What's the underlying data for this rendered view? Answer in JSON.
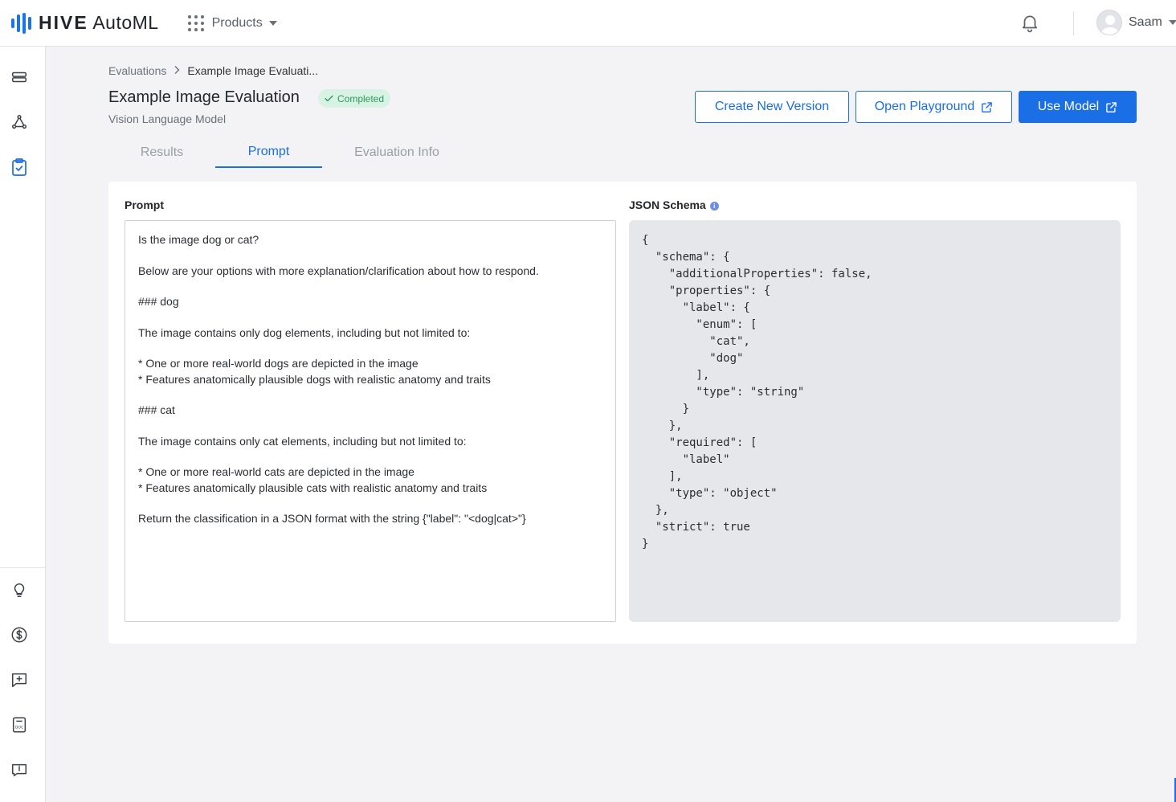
{
  "brand": {
    "name_bold": "HIVE",
    "name_light": "AutoML",
    "accent": "#1a6fe6"
  },
  "header": {
    "products_label": "Products",
    "user_name": "Saam"
  },
  "sidebar": {
    "top_items": [
      {
        "icon": "layers-icon"
      },
      {
        "icon": "nodes-icon"
      },
      {
        "icon": "clipboard-check-icon",
        "active": true
      }
    ],
    "bottom_items": [
      {
        "icon": "lightbulb-icon"
      },
      {
        "icon": "dollar-icon"
      },
      {
        "icon": "feedback-icon"
      },
      {
        "icon": "document-icon"
      },
      {
        "icon": "chat-info-icon"
      }
    ]
  },
  "breadcrumb": {
    "parent": "Evaluations",
    "current": "Example Image Evaluati..."
  },
  "page": {
    "title": "Example Image Evaluation",
    "status": "Completed",
    "subtitle": "Vision Language Model"
  },
  "actions": {
    "create_version": "Create New Version",
    "open_playground": "Open Playground",
    "use_model": "Use Model"
  },
  "tabs": [
    {
      "label": "Results",
      "active": false
    },
    {
      "label": "Prompt",
      "active": true
    },
    {
      "label": "Evaluation Info",
      "active": false
    }
  ],
  "prompt_panel": {
    "label": "Prompt",
    "text": "Is the image dog or cat?\n\nBelow are your options with more explanation/clarification about how to respond.\n\n### dog\n\nThe image contains only dog elements, including but not limited to:\n\n* One or more real-world dogs are depicted in the image\n* Features anatomically plausible dogs with realistic anatomy and traits\n\n### cat\n\nThe image contains only cat elements, including but not limited to:\n\n* One or more real-world cats are depicted in the image\n* Features anatomically plausible cats with realistic anatomy and traits\n\nReturn the classification in a JSON format with the string {\"label\": \"<dog|cat>\"}"
  },
  "schema_panel": {
    "label": "JSON Schema",
    "code": "{\n  \"schema\": {\n    \"additionalProperties\": false,\n    \"properties\": {\n      \"label\": {\n        \"enum\": [\n          \"cat\",\n          \"dog\"\n        ],\n        \"type\": \"string\"\n      }\n    },\n    \"required\": [\n      \"label\"\n    ],\n    \"type\": \"object\"\n  },\n  \"strict\": true\n}"
  }
}
